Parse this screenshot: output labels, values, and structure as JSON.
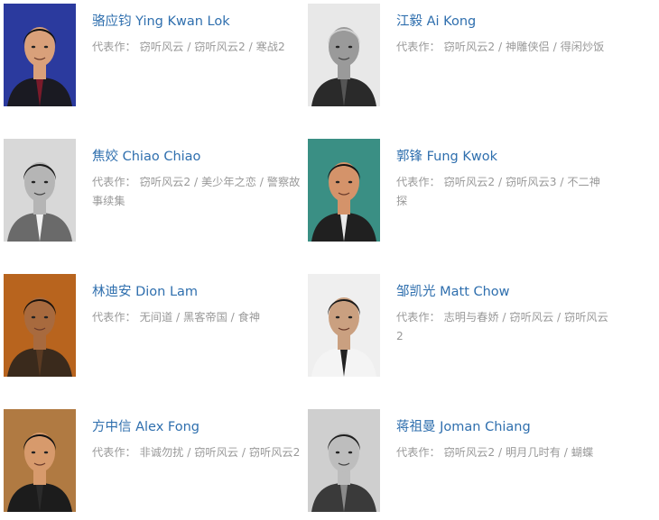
{
  "works_prefix": "代表作：",
  "actors": [
    {
      "name": "骆应钧 Ying Kwan Lok",
      "works": "窃听风云 / 窃听风云2 / 寒战2",
      "photo": {
        "bg": "#2b3a9e",
        "skin": "#d9a07a",
        "hair": "#111111",
        "shirt": "#1a1a22",
        "tie": "#7a1a2a",
        "grayscale": false
      }
    },
    {
      "name": "江毅 Ai Kong",
      "works": "窃听风云2 / 神雕侠侣 / 得闲炒饭",
      "photo": {
        "bg": "#e8e8e8",
        "skin": "#9a9a9a",
        "hair": "#cfcfcf",
        "shirt": "#2a2a2a",
        "tie": "#555555",
        "grayscale": true
      }
    },
    {
      "name": "焦姣 Chiao Chiao",
      "works": "窃听风云2 / 美少年之恋 / 警察故事续集",
      "photo": {
        "bg": "#d8d8d8",
        "skin": "#b5b5b5",
        "hair": "#1a1a1a",
        "shirt": "#6a6a6a",
        "tie": "#f2f2f2",
        "grayscale": true
      }
    },
    {
      "name": "郭锋 Fung Kwok",
      "works": "窃听风云2 / 窃听风云3 / 不二神探",
      "photo": {
        "bg": "#3a8f84",
        "skin": "#d4936a",
        "hair": "#141414",
        "shirt": "#202020",
        "tie": "#e9e9e9",
        "grayscale": false
      }
    },
    {
      "name": "林迪安 Dion Lam",
      "works": "无间道 / 黑客帝国 / 食神",
      "photo": {
        "bg": "#b8641e",
        "skin": "#a86a3e",
        "hair": "#1a120c",
        "shirt": "#3a2a1c",
        "tie": "#5a3a22",
        "grayscale": false
      }
    },
    {
      "name": "邹凯光 Matt Chow",
      "works": "志明与春娇 / 窃听风云 / 窃听风云2",
      "photo": {
        "bg": "#efefef",
        "skin": "#caa080",
        "hair": "#1a1a1a",
        "shirt": "#f4f4f4",
        "tie": "#222222",
        "grayscale": false
      }
    },
    {
      "name": "方中信 Alex Fong",
      "works": "非诚勿扰 / 窃听风云 / 窃听风云2",
      "photo": {
        "bg": "#b07a42",
        "skin": "#d79a6c",
        "hair": "#121212",
        "shirt": "#1c1c1c",
        "tie": "#2a2a2a",
        "grayscale": false
      }
    },
    {
      "name": "蒋祖曼 Joman Chiang",
      "works": "窃听风云2 / 明月几时有 / 蝴蝶",
      "photo": {
        "bg": "#cfcfcf",
        "skin": "#bdbdbd",
        "hair": "#1e1e1e",
        "shirt": "#3a3a3a",
        "tie": "#8a8a8a",
        "grayscale": true
      }
    }
  ]
}
